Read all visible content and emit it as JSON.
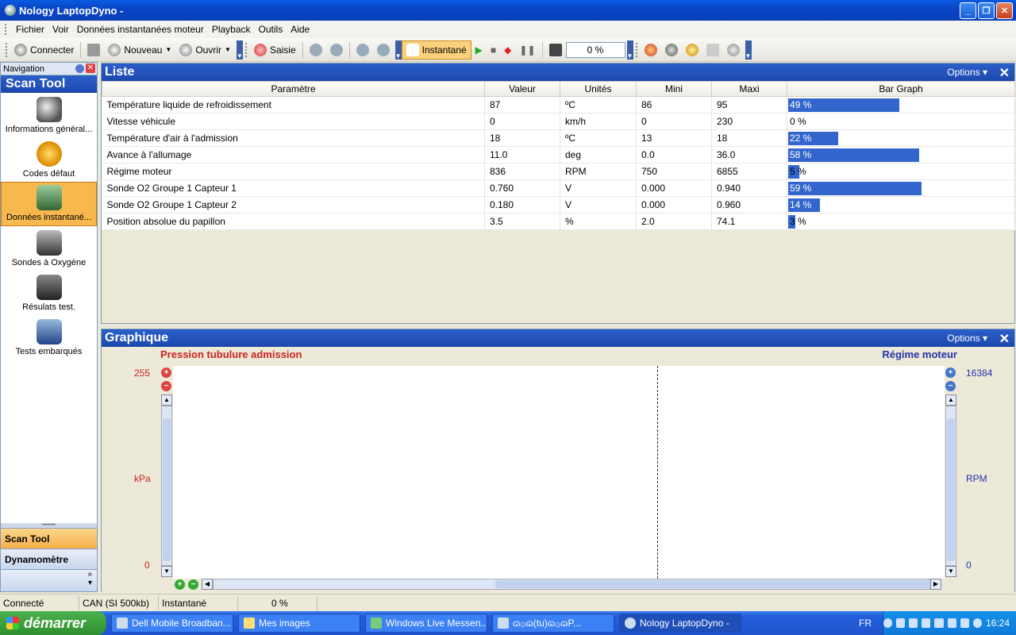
{
  "window": {
    "title": "Nology LaptopDyno -"
  },
  "menu": [
    "Fichier",
    "Voir",
    "Données instantanées moteur",
    "Playback",
    "Outils",
    "Aide"
  ],
  "toolbar": {
    "connect": "Connecter",
    "new": "Nouveau",
    "open": "Ouvrir",
    "capture": "Saisie",
    "instant": "Instantané",
    "progress": "0 %"
  },
  "nav": {
    "header": "Navigation",
    "title": "Scan Tool",
    "items": [
      {
        "label": "Informations général...",
        "icon": "magnifier-icon"
      },
      {
        "label": "Codes défaut",
        "icon": "warning-icon"
      },
      {
        "label": "Données instantané...",
        "icon": "monitor-icon"
      },
      {
        "label": "Sondes à Oxygène",
        "icon": "oxygen-sensor-icon"
      },
      {
        "label": "Résulats test.",
        "icon": "test-results-icon"
      },
      {
        "label": "Tests embarqués",
        "icon": "onboard-tests-icon"
      }
    ],
    "tabs": [
      "Scan Tool",
      "Dynamomètre"
    ]
  },
  "liste": {
    "title": "Liste",
    "options": "Options",
    "columns": [
      "Paramètre",
      "Valeur",
      "Unités",
      "Mini",
      "Maxi",
      "Bar Graph"
    ],
    "rows": [
      {
        "param": "Température liquide de refroidissement",
        "value": "87",
        "unit": "ºC",
        "min": "86",
        "max": "95",
        "pct": 49,
        "label": "49 %"
      },
      {
        "param": "Vitesse véhicule",
        "value": "0",
        "unit": "km/h",
        "min": "0",
        "max": "230",
        "pct": 0,
        "label": "0 %"
      },
      {
        "param": "Température d'air à l'admission",
        "value": "18",
        "unit": "ºC",
        "min": "13",
        "max": "18",
        "pct": 22,
        "label": "22 %"
      },
      {
        "param": "Avance à l'allumage",
        "value": "11.0",
        "unit": "deg",
        "min": "0.0",
        "max": "36.0",
        "pct": 58,
        "label": "58 %"
      },
      {
        "param": "Régime moteur",
        "value": "836",
        "unit": "RPM",
        "min": "750",
        "max": "6855",
        "pct": 5,
        "label": "5 %"
      },
      {
        "param": "Sonde O2 Groupe 1 Capteur 1",
        "value": "0.760",
        "unit": "V",
        "min": "0.000",
        "max": "0.940",
        "pct": 59,
        "label": "59 %"
      },
      {
        "param": "Sonde O2 Groupe 1 Capteur 2",
        "value": "0.180",
        "unit": "V",
        "min": "0.000",
        "max": "0.960",
        "pct": 14,
        "label": "14 %"
      },
      {
        "param": "Position absolue du papillon",
        "value": "3.5",
        "unit": "%",
        "min": "2.0",
        "max": "74.1",
        "pct": 3,
        "label": "3 %"
      }
    ]
  },
  "graph": {
    "title": "Graphique",
    "options": "Options",
    "left": {
      "name": "Pression tubulure admission",
      "max": "255",
      "unit": "kPa",
      "min": "0"
    },
    "right": {
      "name": "Régime moteur",
      "max": "16384",
      "unit": "RPM",
      "min": "0"
    }
  },
  "status": [
    "Connecté",
    "CAN (SI 500kb)",
    "Instantané",
    "0 %"
  ],
  "taskbar": {
    "start": "démarrer",
    "tasks": [
      "Dell Mobile Broadban...",
      "Mes images",
      "Windows Live Messen...",
      "ɷ۞ɷ(tu)ɷ۞ɷP...",
      "Nology LaptopDyno -"
    ],
    "lang": "FR",
    "clock": "16:24"
  },
  "colors": {
    "bar": "#3366cc",
    "header": "#1c48ad",
    "selected": "#f8b84e"
  }
}
